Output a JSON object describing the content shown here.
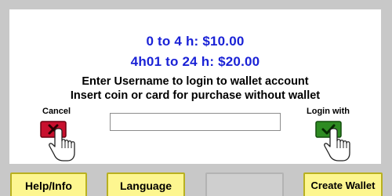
{
  "rates": {
    "line1": "0 to 4 h: $10.00",
    "line2": "4h01 to 24 h: $20.00"
  },
  "instructions": {
    "line1": "Enter Username to login to wallet account",
    "line2": "Insert coin or card for purchase without wallet"
  },
  "cancel": {
    "label": "Cancel",
    "icon": "hand-pressing-red-x-icon",
    "color": "#c8102e"
  },
  "login": {
    "label": "Login with",
    "icon": "hand-pressing-green-check-icon",
    "color": "#2e8b22"
  },
  "username_field": {
    "value": "",
    "placeholder": ""
  },
  "bottom_bar": {
    "help_label": "Help/Info",
    "language_label": "Language",
    "blank_label": "",
    "create_wallet_label": "Create Wallet"
  },
  "colors": {
    "background": "#c8c8c8",
    "panel": "#ffffff",
    "rate_text": "#1a22d6",
    "button_yellow": "#fdf690"
  }
}
